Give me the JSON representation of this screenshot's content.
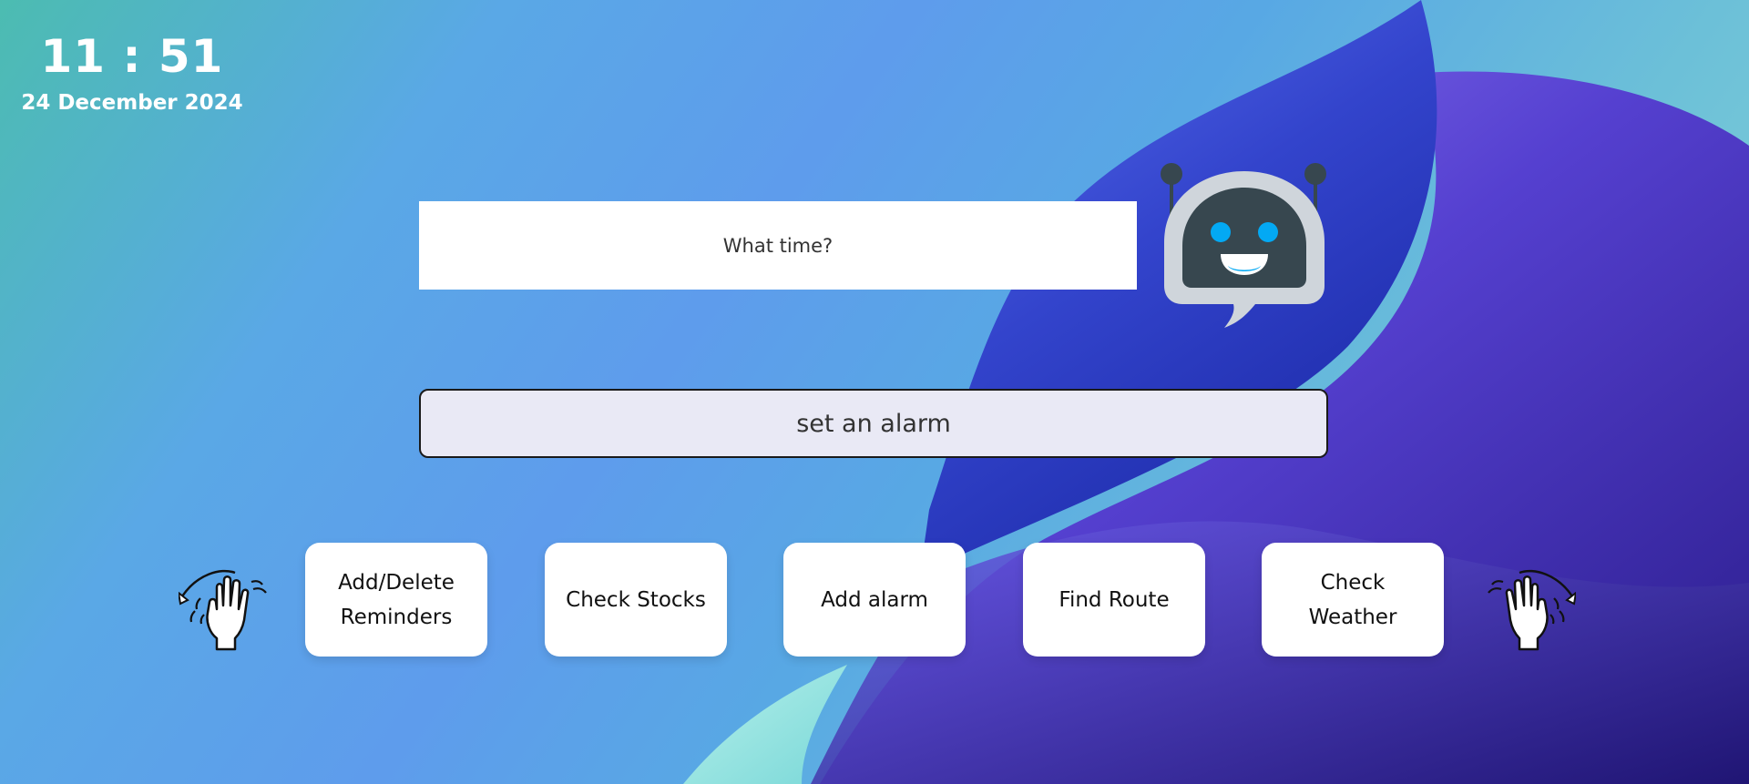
{
  "clock": {
    "time": "11 : 51",
    "date": "24 December 2024"
  },
  "assistant": {
    "reply": "What time?",
    "icon": "robot-chat-icon"
  },
  "command": {
    "value": "set an alarm"
  },
  "actions": [
    {
      "label": "Add/Delete Reminders"
    },
    {
      "label": "Check Stocks"
    },
    {
      "label": "Add alarm"
    },
    {
      "label": "Find Route"
    },
    {
      "label": "Check Weather"
    }
  ],
  "gestures": {
    "left_icon": "wave-left-hand-icon",
    "right_icon": "wave-right-hand-icon"
  },
  "colors": {
    "bot_body": "#cfd5db",
    "bot_face": "#37474f",
    "bot_eyes": "#03a9f4",
    "input_bg": "#e9e9f5"
  }
}
